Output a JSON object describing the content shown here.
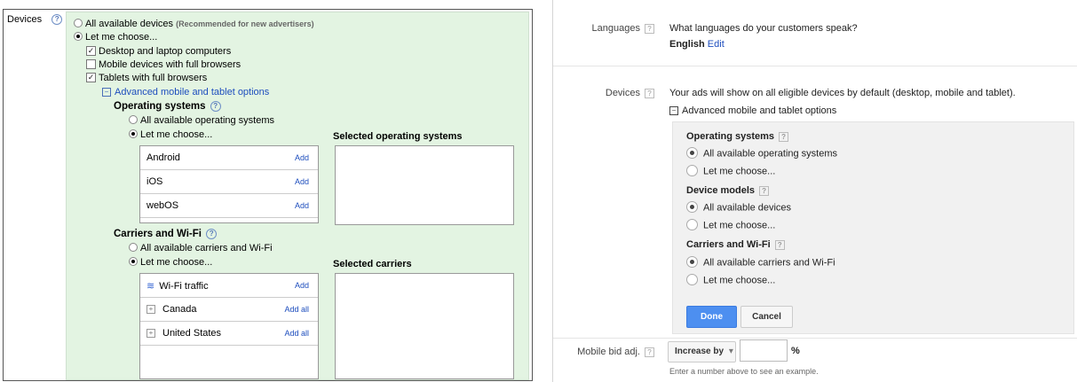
{
  "left": {
    "devices_label": "Devices",
    "all_devices": "All available devices",
    "all_devices_note": "(Recommended for new advertisers)",
    "let_me_choose": "Let me choose...",
    "desktop": "Desktop and laptop computers",
    "mobile": "Mobile devices with full browsers",
    "tablets": "Tablets with full browsers",
    "advanced_link": "Advanced mobile and tablet options",
    "os_heading": "Operating systems",
    "all_os": "All available operating systems",
    "let_me_choose_os": "Let me choose...",
    "selected_os_heading": "Selected operating systems",
    "os_list": [
      {
        "name": "Android",
        "action": "Add"
      },
      {
        "name": "iOS",
        "action": "Add"
      },
      {
        "name": "webOS",
        "action": "Add"
      }
    ],
    "carriers_heading": "Carriers and Wi-Fi",
    "all_carriers": "All available carriers and Wi-Fi",
    "let_me_choose_carriers": "Let me choose...",
    "selected_carriers_heading": "Selected carriers",
    "carrier_list": [
      {
        "name": "Wi-Fi traffic",
        "action": "Add"
      },
      {
        "name": "Canada",
        "action": "Add all"
      },
      {
        "name": "United States",
        "action": "Add all"
      }
    ],
    "checked": {
      "desktop": true,
      "mobile": false,
      "tablets": true
    }
  },
  "right": {
    "languages_label": "Languages",
    "languages_question": "What languages do your customers speak?",
    "languages_value": "English",
    "edit_link": "Edit",
    "devices_label": "Devices",
    "devices_desc": "Your ads will show on all eligible devices by default (desktop, mobile and tablet).",
    "advanced_link": "Advanced mobile and tablet options",
    "os_heading": "Operating systems",
    "all_os": "All available operating systems",
    "choose_os": "Let me choose...",
    "models_heading": "Device models",
    "all_models": "All available devices",
    "choose_models": "Let me choose...",
    "carriers_heading": "Carriers and Wi-Fi",
    "all_carriers": "All available carriers and Wi-Fi",
    "choose_carriers": "Let me choose...",
    "done": "Done",
    "cancel": "Cancel",
    "bid_label": "Mobile bid adj.",
    "bid_dropdown": "Increase by",
    "percent": "%",
    "bid_hint": "Enter a number above to see an example.",
    "help_glyph": "?"
  }
}
